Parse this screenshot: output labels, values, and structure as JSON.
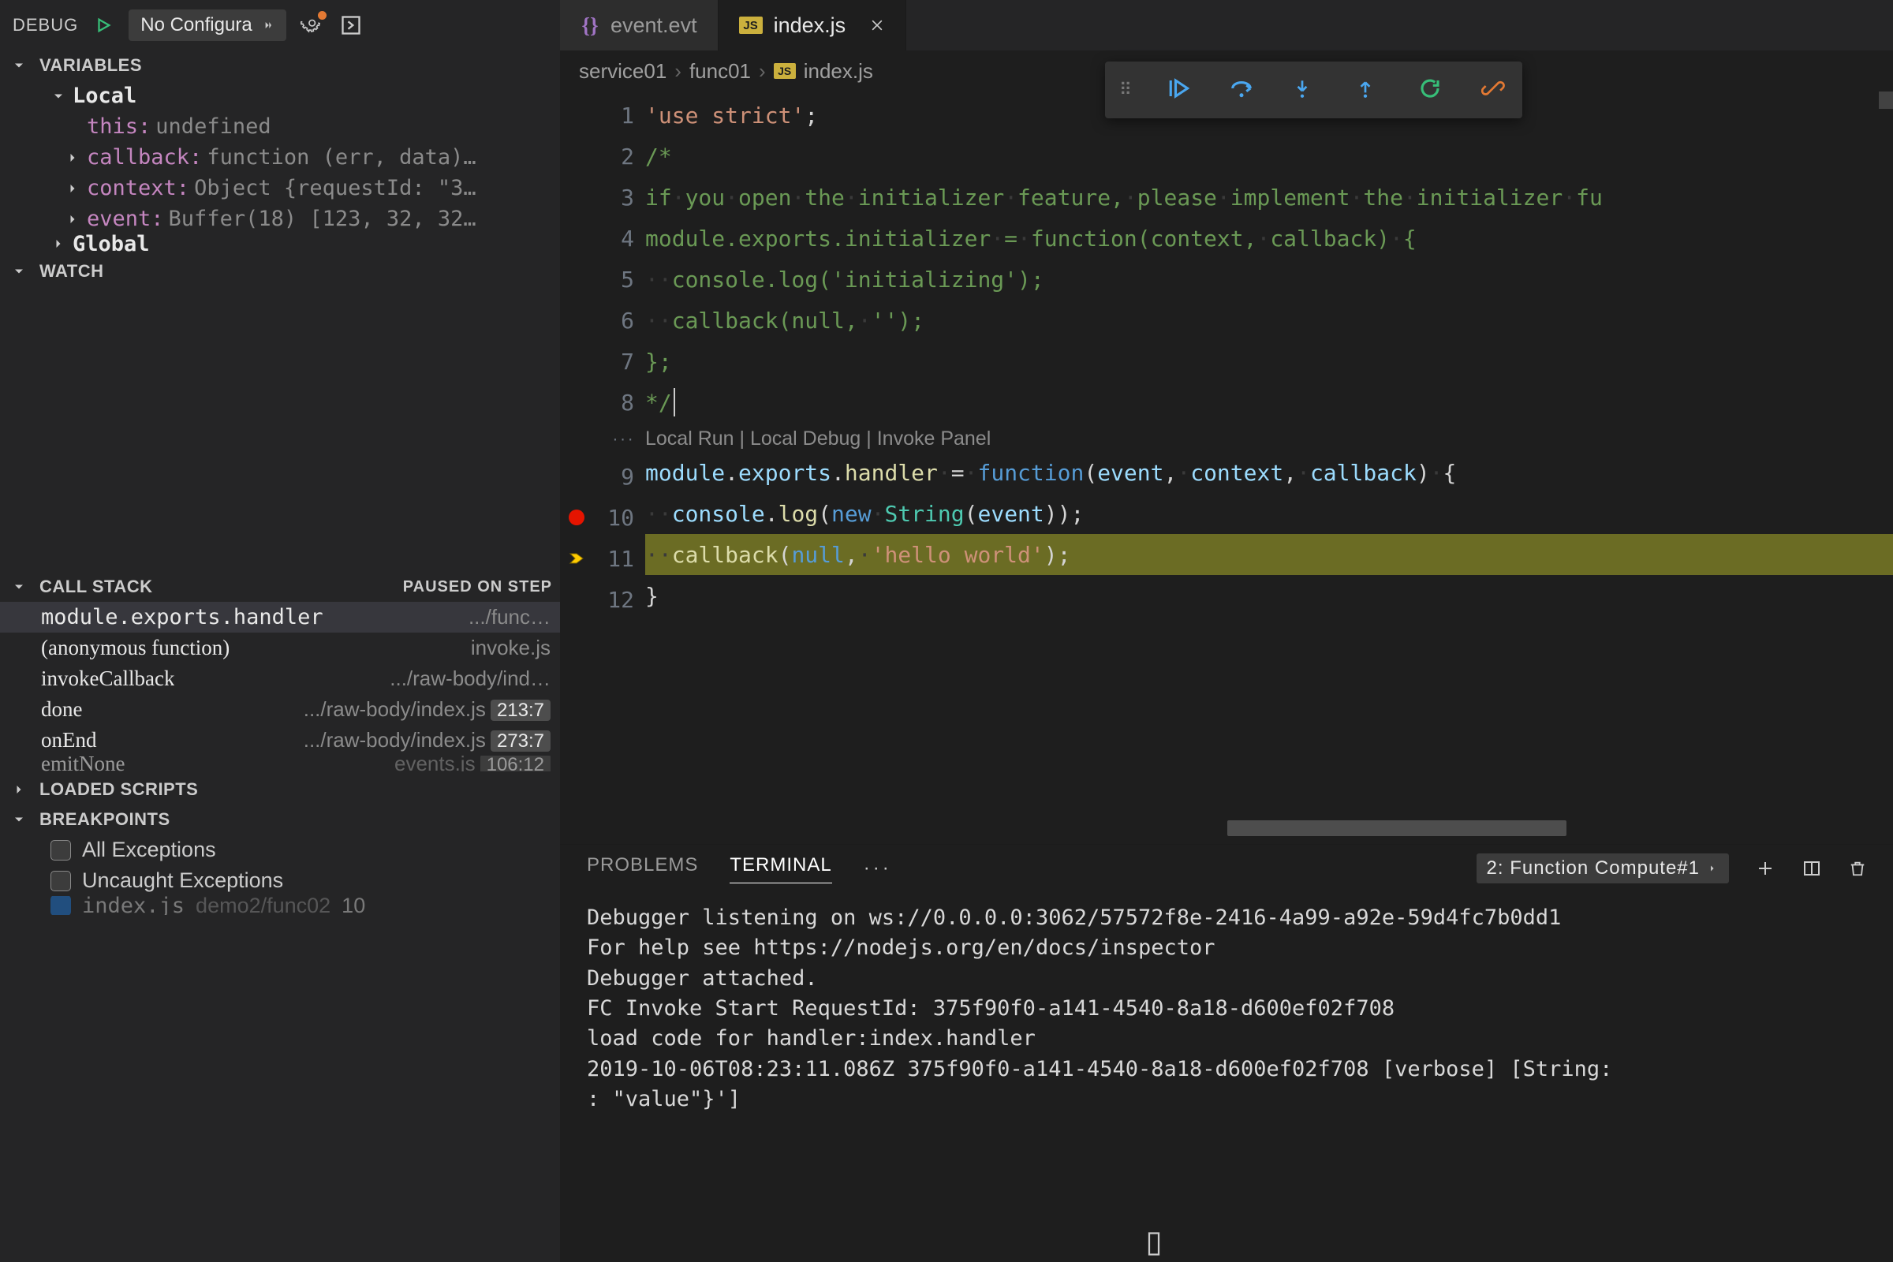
{
  "debugToolbar": {
    "label": "DEBUG",
    "config": "No Configura"
  },
  "sections": {
    "variables": {
      "title": "VARIABLES",
      "scopes": [
        {
          "name": "Local",
          "expanded": true,
          "vars": [
            {
              "name": "this",
              "value": "undefined",
              "expandable": false
            },
            {
              "name": "callback",
              "value": "function (err, data)…",
              "expandable": true
            },
            {
              "name": "context",
              "value": "Object {requestId: \"3…",
              "expandable": true
            },
            {
              "name": "event",
              "value": "Buffer(18) [123, 32, 32…",
              "expandable": true
            }
          ]
        },
        {
          "name": "Global",
          "expanded": false,
          "cut": true
        }
      ]
    },
    "watch": {
      "title": "WATCH"
    },
    "callstack": {
      "title": "CALL STACK",
      "status": "PAUSED ON STEP",
      "frames": [
        {
          "fn": "module.exports.handler",
          "src": ".../func…",
          "pos": ""
        },
        {
          "fn": "(anonymous function)",
          "src": "invoke.js",
          "pos": ""
        },
        {
          "fn": "invokeCallback",
          "src": ".../raw-body/ind…",
          "pos": ""
        },
        {
          "fn": "done",
          "src": ".../raw-body/index.js",
          "pos": "213:7"
        },
        {
          "fn": "onEnd",
          "src": ".../raw-body/index.js",
          "pos": "273:7"
        },
        {
          "fn": "emitNone",
          "src": "events.js",
          "pos": "106:12",
          "cut": true
        }
      ]
    },
    "loadedScripts": {
      "title": "LOADED SCRIPTS"
    },
    "breakpoints": {
      "title": "BREAKPOINTS",
      "items": [
        {
          "label": "All Exceptions",
          "checked": false
        },
        {
          "label": "Uncaught Exceptions",
          "checked": false
        },
        {
          "label": "index.js",
          "path": "demo2/func02",
          "pos": "10",
          "checked": true,
          "cut": true
        }
      ]
    }
  },
  "tabs": [
    {
      "icon": "braces",
      "iconColor": "#a074c4",
      "label": "event.evt",
      "active": false
    },
    {
      "icon": "js",
      "iconColor": "#cbb03d",
      "label": "index.js",
      "active": true,
      "closable": true
    }
  ],
  "breadcrumb": {
    "parts": [
      "service01",
      "func01"
    ],
    "fileIcon": "js",
    "file": "index.js"
  },
  "codelens": "Local Run | Local Debug | Invoke Panel",
  "code": {
    "lines": [
      {
        "n": 1,
        "html": "<span class='tok-str'>'use&nbsp;strict'</span><span class='tok-punc'>;</span>"
      },
      {
        "n": 2,
        "html": "<span class='tok-com'>/*</span>"
      },
      {
        "n": 3,
        "html": "<span class='tok-com'>if</span><span class='ws-dot'>·</span><span class='tok-com'>you</span><span class='ws-dot'>·</span><span class='tok-com'>open</span><span class='ws-dot'>·</span><span class='tok-com'>the</span><span class='ws-dot'>·</span><span class='tok-com'>initializer</span><span class='ws-dot'>·</span><span class='tok-com'>feature,</span><span class='ws-dot'>·</span><span class='tok-com'>please</span><span class='ws-dot'>·</span><span class='tok-com'>implement</span><span class='ws-dot'>·</span><span class='tok-com'>the</span><span class='ws-dot'>·</span><span class='tok-com'>initializer</span><span class='ws-dot'>·</span><span class='tok-com'>fu</span>"
      },
      {
        "n": 4,
        "html": "<span class='tok-com'>module.exports.initializer</span><span class='ws-dot'>·</span><span class='tok-com'>=</span><span class='ws-dot'>·</span><span class='tok-com'>function(context,</span><span class='ws-dot'>·</span><span class='tok-com'>callback)</span><span class='ws-dot'>·</span><span class='tok-com'>{</span>"
      },
      {
        "n": 5,
        "html": "<span class='ws-dot'>··</span><span class='tok-com'>console.log('initializing');</span>"
      },
      {
        "n": 6,
        "html": "<span class='ws-dot'>··</span><span class='tok-com'>callback(null,</span><span class='ws-dot'>·</span><span class='tok-com'>'');</span>"
      },
      {
        "n": 7,
        "html": "<span class='tok-com'>};</span>"
      },
      {
        "n": 8,
        "html": "<span class='tok-com'>*/</span><span style='border-left:2px solid #cccccc; height:1.3em; display:inline-block; vertical-align:middle; margin-left:2px;'></span>"
      },
      {
        "codelens": true
      },
      {
        "n": 9,
        "html": "<span class='tok-prop'>module</span><span class='tok-punc'>.</span><span class='tok-prop'>exports</span><span class='tok-punc'>.</span><span class='tok-fn'>handler</span><span class='ws-dot'>·</span><span class='tok-punc'>=</span><span class='ws-dot'>·</span><span class='tok-kw'>function</span><span class='tok-punc'>(</span><span class='tok-prop'>event</span><span class='tok-punc'>,</span><span class='ws-dot'>·</span><span class='tok-prop'>context</span><span class='tok-punc'>,</span><span class='ws-dot'>·</span><span class='tok-prop'>callback</span><span class='tok-punc'>)</span><span class='ws-dot'>·</span><span class='tok-punc'>{</span>"
      },
      {
        "n": 10,
        "mark": "breakpoint",
        "html": "<span class='ws-dot'>··</span><span class='tok-prop'>console</span><span class='tok-punc'>.</span><span class='tok-fn'>log</span><span class='tok-punc'>(</span><span class='tok-new'>new</span><span class='ws-dot'>·</span><span class='tok-id' style='color:#4ec9b0'>String</span><span class='tok-punc'>(</span><span class='tok-prop'>event</span><span class='tok-punc'>));</span>"
      },
      {
        "n": 11,
        "mark": "current",
        "hl": true,
        "html": "<span class='ws-dot'>··</span><span class='tok-fn'>callback</span><span class='tok-punc'>(</span><span class='tok-kw'>null</span><span class='tok-punc'>,</span><span class='ws-dot'>·</span><span class='tok-str'>'hello&nbsp;world'</span><span class='tok-punc'>);</span>"
      },
      {
        "n": 12,
        "html": "<span class='tok-punc'>}</span>"
      }
    ]
  },
  "panel": {
    "tabs": {
      "problems": "PROBLEMS",
      "terminal": "TERMINAL"
    },
    "select": {
      "label": "2: Function Compute#1"
    },
    "terminal": "Debugger listening on ws://0.0.0.0:3062/57572f8e-2416-4a99-a92e-59d4fc7b0dd1\nFor help see https://nodejs.org/en/docs/inspector\nDebugger attached.\nFC Invoke Start RequestId: 375f90f0-a141-4540-8a18-d600ef02f708\nload code for handler:index.handler\n2019-10-06T08:23:11.086Z 375f90f0-a141-4540-8a18-d600ef02f708 [verbose] [String: \n: \"value\"}']"
  }
}
